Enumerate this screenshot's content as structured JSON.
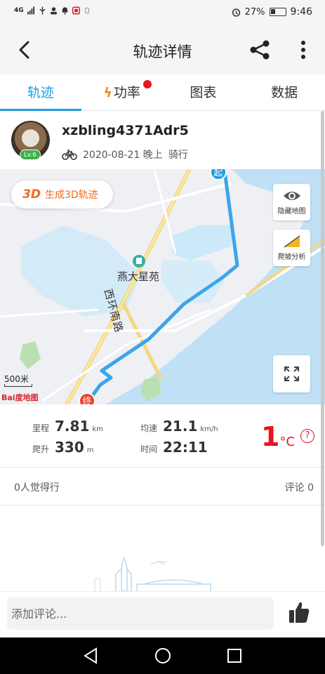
{
  "status_bar": {
    "network": "4G",
    "battery": "27%",
    "time": "9:46"
  },
  "header": {
    "title": "轨迹详情",
    "back_icon": "chevron-left-icon",
    "share_icon": "share-icon",
    "more_icon": "more-vertical-icon"
  },
  "tabs": [
    {
      "label": "轨迹",
      "active": true
    },
    {
      "label": "功率",
      "icon": "bolt-icon",
      "badge": true
    },
    {
      "label": "图表"
    },
    {
      "label": "数据"
    }
  ],
  "user": {
    "name": "xzbling4371Adr5",
    "level": "Lv.6",
    "datetime": "2020-08-21 晚上",
    "activity": "骑行"
  },
  "map": {
    "button_3d": {
      "prefix": "3D",
      "label": "生成3D轨迹"
    },
    "hide_map_label": "隐藏地图",
    "climb_label": "爬坡分析",
    "poi_label": "燕大星苑",
    "road_label": "西环南路",
    "start_marker": "起",
    "end_marker": "终",
    "scale_label": "500米",
    "provider_label": "Bai度地图",
    "route_color": "#3aa6e8"
  },
  "stats": {
    "distance": {
      "label": "里程",
      "value": "7.81",
      "unit": "km"
    },
    "speed": {
      "label": "均速",
      "value": "21.1",
      "unit": "km/h"
    },
    "climb": {
      "label": "爬升",
      "value": "330",
      "unit": "m"
    },
    "time": {
      "label": "时间",
      "value": "22:11"
    },
    "temperature": {
      "value": "1",
      "unit": "°C"
    }
  },
  "social": {
    "likes_text": "0人觉得行",
    "comments_text": "评论 0"
  },
  "comment": {
    "placeholder": "添加评论..."
  },
  "colors": {
    "accent": "#1a9ee0",
    "alert": "#e8141e",
    "orange": "#f28a1a"
  }
}
